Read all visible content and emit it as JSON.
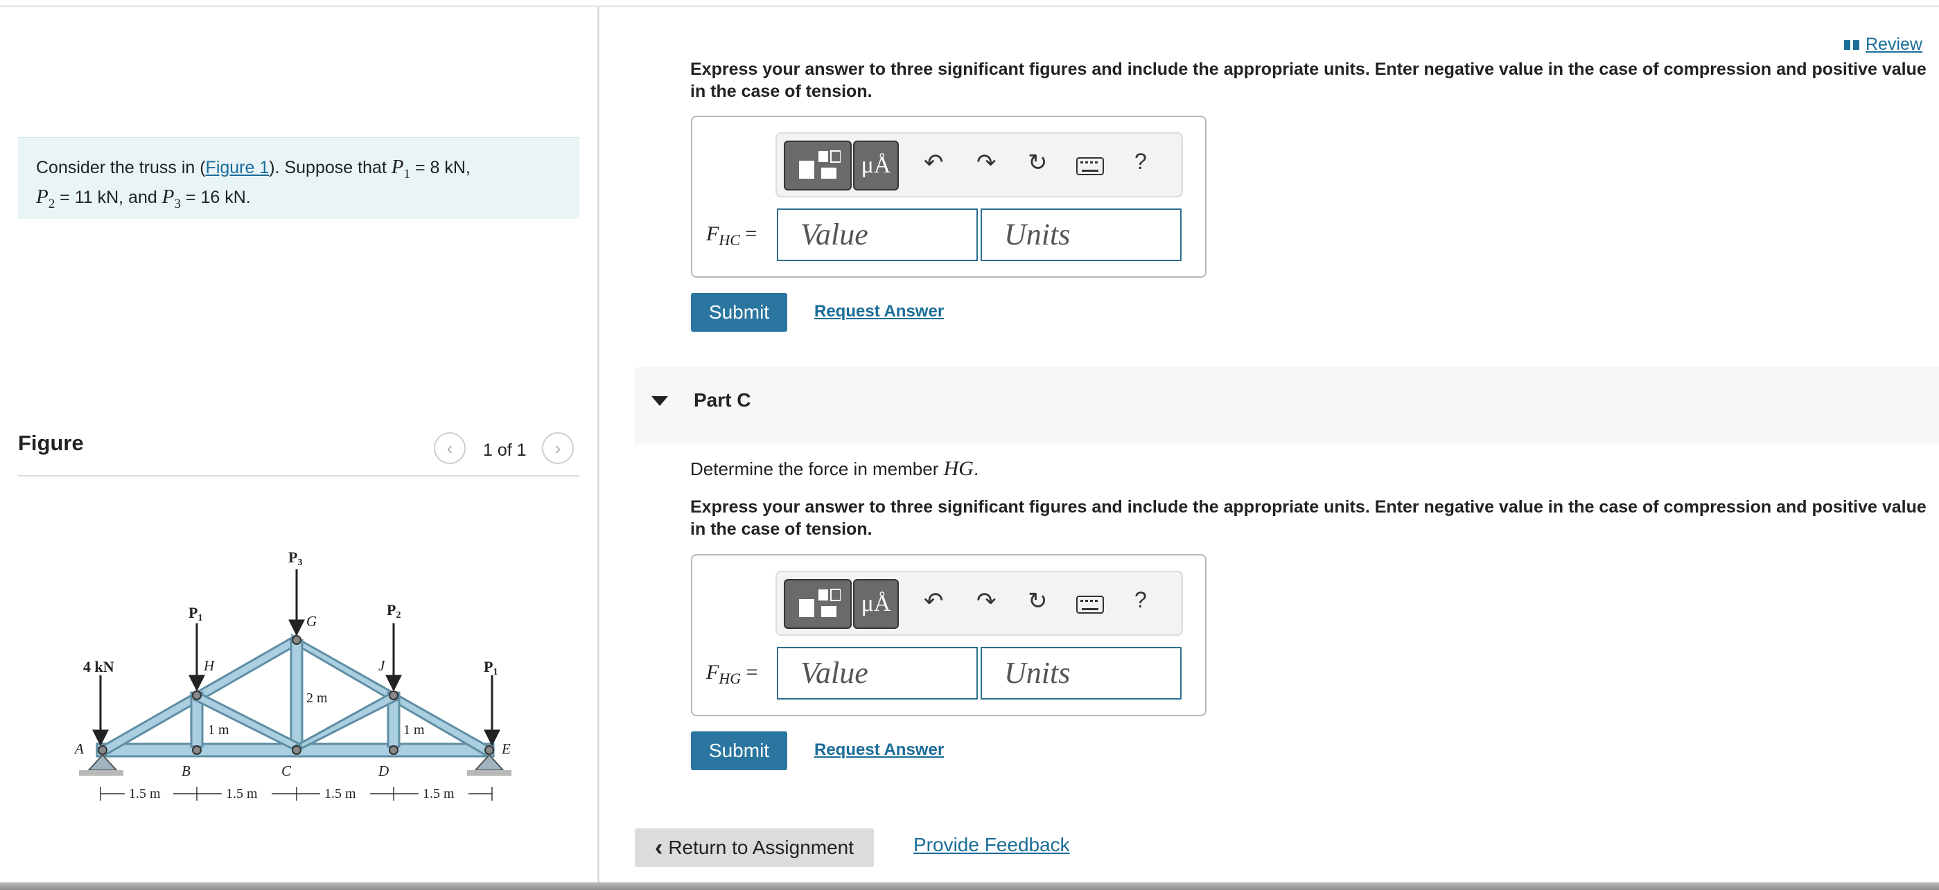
{
  "problem": {
    "intro_prefix": "Consider the truss in (",
    "figure_link": "Figure 1",
    "intro_suffix": "). Suppose that",
    "p1_value": "= 8 kN,",
    "p2_value": "= 11 kN, and",
    "p3_value": "= 16 kN."
  },
  "figure": {
    "title": "Figure",
    "counter": "1 of 1",
    "prev_icon": "chevron-left-icon",
    "next_icon": "chevron-right-icon",
    "labels": {
      "p1": "P",
      "p2": "P",
      "p3": "P",
      "sub1": "1",
      "sub2": "2",
      "sub3": "3",
      "load_4kn": "4 kN",
      "node_a": "A",
      "node_b": "B",
      "node_c": "C",
      "node_d": "D",
      "node_e": "E",
      "node_g": "G",
      "node_h": "H",
      "node_j": "J",
      "dim_2m": "2 m",
      "dim_1m_left": "1 m",
      "dim_1m_right": "1 m",
      "span_1": "1.5 m",
      "span_2": "1.5 m",
      "span_3": "1.5 m",
      "span_4": "1.5 m"
    }
  },
  "review_link": "Review",
  "part_b": {
    "instructions": "Express your answer to three significant figures and include the appropriate units. Enter negative value in the case of compression and positive value in the case of tension.",
    "lhs_var": "F",
    "lhs_sub": "HC",
    "lhs_eq": " =",
    "value_placeholder": "Value",
    "units_placeholder": "Units",
    "submit_label": "Submit",
    "request_label": "Request Answer"
  },
  "part_c": {
    "title": "Part C",
    "question_prefix": "Determine the force in member",
    "question_member": "HG",
    "question_suffix": ".",
    "instructions": "Express your answer to three significant figures and include the appropriate units. Enter negative value in the case of compression and positive value in the case of tension.",
    "lhs_var": "F",
    "lhs_sub": "HG",
    "lhs_eq": " =",
    "value_placeholder": "Value",
    "units_placeholder": "Units",
    "submit_label": "Submit",
    "request_label": "Request Answer"
  },
  "toolbar": {
    "templates_icon": "templates-icon",
    "units_label": "μÅ",
    "undo_icon": "undo-icon",
    "redo_icon": "redo-icon",
    "reset_icon": "reset-icon",
    "keyboard_icon": "keyboard-icon",
    "help_label": "?"
  },
  "footer": {
    "return_label": "Return to Assignment",
    "feedback_label": "Provide Feedback"
  },
  "colors": {
    "accent": "#2b76a0",
    "link": "#1a6d99",
    "problem_bg": "#e8f4f6",
    "truss_fill": "#a9cfe0"
  }
}
